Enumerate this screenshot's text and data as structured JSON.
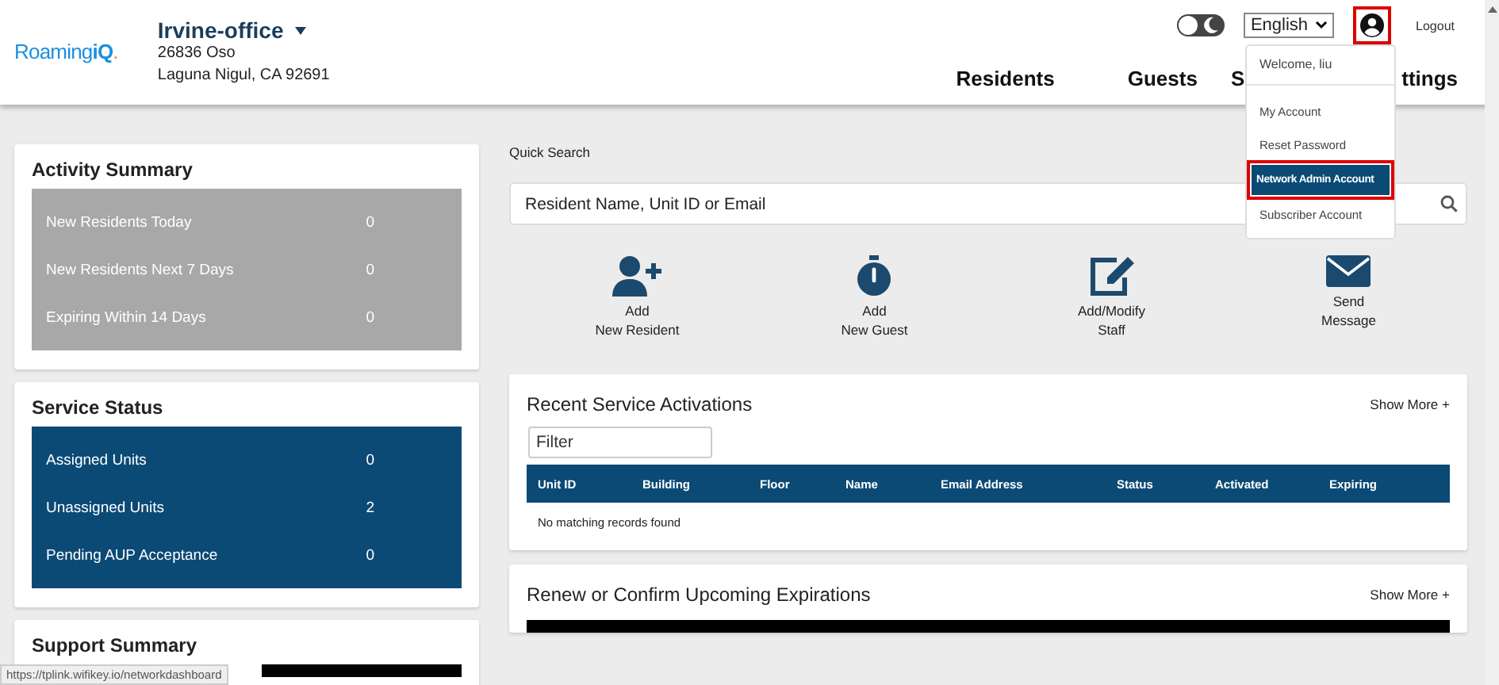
{
  "header": {
    "logo": {
      "main": "Roaming",
      "accent": "iQ",
      "dot": "."
    },
    "property": {
      "name": "Irvine-office",
      "address_line_1": "26836 Oso",
      "address_line_2": "Laguna Nigul, CA 92691"
    },
    "theme_toggle": {
      "on": false
    },
    "language": "English",
    "logout": "Logout",
    "nav": [
      {
        "label": "Residents"
      },
      {
        "label": "Guests"
      },
      {
        "label": "S"
      },
      {
        "label": "ttings"
      }
    ]
  },
  "account_menu": {
    "welcome": "Welcome, liu",
    "items": [
      {
        "label": "My Account",
        "selected": false
      },
      {
        "label": "Reset Password",
        "selected": false
      },
      {
        "label": "Network Admin Account",
        "selected": true
      },
      {
        "label": "Subscriber Account",
        "selected": false
      }
    ]
  },
  "activity_summary": {
    "title": "Activity Summary",
    "rows": [
      {
        "label": "New Residents Today",
        "value": "0"
      },
      {
        "label": "New Residents Next 7 Days",
        "value": "0"
      },
      {
        "label": "Expiring Within 14 Days",
        "value": "0"
      }
    ]
  },
  "service_status": {
    "title": "Service Status",
    "rows": [
      {
        "label": "Assigned Units",
        "value": "0"
      },
      {
        "label": "Unassigned Units",
        "value": "2"
      },
      {
        "label": "Pending AUP Acceptance",
        "value": "0"
      }
    ]
  },
  "support_summary": {
    "title": "Support Summary"
  },
  "quick_search": {
    "label": "Quick Search",
    "placeholder": "Resident Name, Unit ID or Email"
  },
  "actions": [
    {
      "kind": "add-resident",
      "line_1": "Add",
      "line_2": "New Resident"
    },
    {
      "kind": "add-guest",
      "line_1": "Add",
      "line_2": "New Guest"
    },
    {
      "kind": "edit-staff",
      "line_1": "Add/Modify",
      "line_2": "Staff"
    },
    {
      "kind": "message",
      "line_1": "Send",
      "line_2": "Message"
    }
  ],
  "recent_activations": {
    "title": "Recent Service Activations",
    "show_more": "Show More +",
    "filter_placeholder": "Filter",
    "columns": [
      "Unit ID",
      "Building",
      "Floor",
      "Name",
      "Email Address",
      "Status",
      "Activated",
      "Expiring"
    ],
    "empty": "No matching records found"
  },
  "upcoming_expirations": {
    "title": "Renew or Confirm Upcoming Expirations",
    "show_more": "Show More +"
  },
  "status_url": "https://tplink.wifikey.io/networkdashboard"
}
